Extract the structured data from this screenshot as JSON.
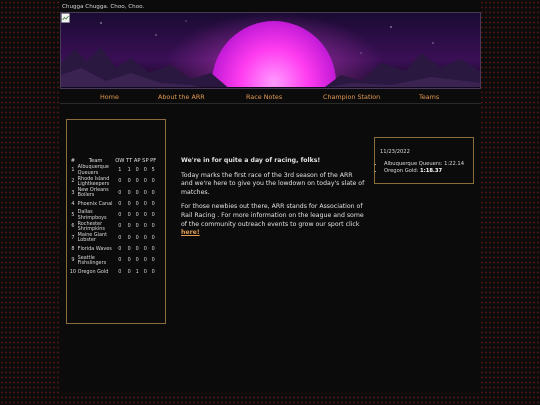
{
  "site": {
    "tagline": "Chugga Chugga. Choo, Choo."
  },
  "nav": {
    "items": [
      "Home",
      "About the ARR",
      "Race Notes",
      "Champion Station",
      "Teams"
    ]
  },
  "standings": {
    "headers": [
      "#",
      "Team",
      "OW",
      "TT",
      "AP",
      "SP",
      "PF"
    ],
    "rows": [
      {
        "rank": "1",
        "team": "Albuquerque Queuers",
        "ow": "1",
        "tt": "1",
        "ap": "0",
        "sp": "0",
        "pf": "5"
      },
      {
        "rank": "2",
        "team": "Rhode Island Lightkeepers",
        "ow": "0",
        "tt": "0",
        "ap": "0",
        "sp": "0",
        "pf": "0"
      },
      {
        "rank": "3",
        "team": "New Orleans Boilers",
        "ow": "0",
        "tt": "0",
        "ap": "0",
        "sp": "0",
        "pf": "0"
      },
      {
        "rank": "4",
        "team": "Phoenix Canal",
        "ow": "0",
        "tt": "0",
        "ap": "0",
        "sp": "0",
        "pf": "0"
      },
      {
        "rank": "5",
        "team": "Dallas Shrimpboys",
        "ow": "0",
        "tt": "0",
        "ap": "0",
        "sp": "0",
        "pf": "0"
      },
      {
        "rank": "6",
        "team": "Rochester Shrimpkins",
        "ow": "0",
        "tt": "0",
        "ap": "0",
        "sp": "0",
        "pf": "0"
      },
      {
        "rank": "7",
        "team": "Maine Giant Lobster",
        "ow": "0",
        "tt": "0",
        "ap": "0",
        "sp": "0",
        "pf": "0"
      },
      {
        "rank": "8",
        "team": "Florida Waves",
        "ow": "0",
        "tt": "0",
        "ap": "0",
        "sp": "0",
        "pf": "0"
      },
      {
        "rank": "9",
        "team": "Seattle Fishslingers",
        "ow": "0",
        "tt": "0",
        "ap": "0",
        "sp": "0",
        "pf": "0"
      },
      {
        "rank": "10",
        "team": "Oregon Gold",
        "ow": "0",
        "tt": "0",
        "ap": "1",
        "sp": "0",
        "pf": "0"
      }
    ]
  },
  "main": {
    "heading": "We're in for quite a day of racing, folks!",
    "para1": "Today marks the first race of the 3rd season of the ARR and we're here to give you the lowdown on today's slate of matches.",
    "para2": "For those newbies out there, ARR stands for Association of Rail Racing . For more information on the league and some of the community outreach events to grow our sport click ",
    "link": "here!"
  },
  "results": {
    "date": "11/23/2022",
    "items": [
      {
        "team": "Albuquerque Queuers:",
        "time": "1:22.14",
        "bold": false
      },
      {
        "team": "Oregon Gold:",
        "time": "1:18.37",
        "bold": true
      }
    ]
  },
  "colors": {
    "accent": "#e39a52",
    "border": "#8a6d3b",
    "banner_sun": "#ff3cf0",
    "dot_pattern": "#5a1414"
  }
}
